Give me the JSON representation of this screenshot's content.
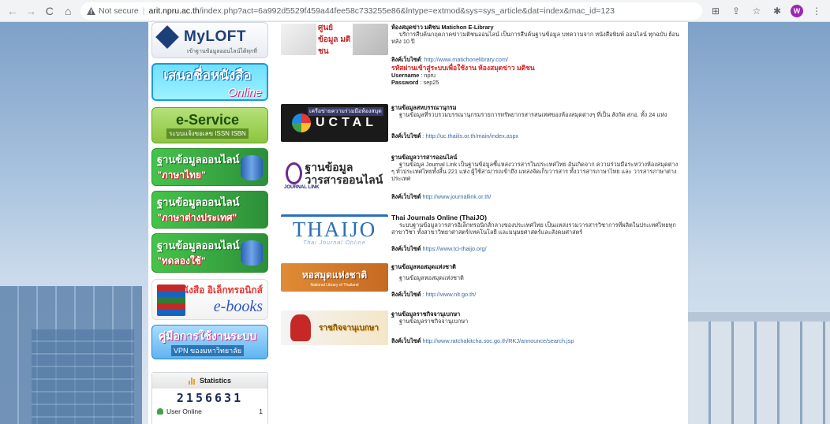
{
  "browser": {
    "nav": {
      "back": "←",
      "forward": "→",
      "reload": "C",
      "home": "⌂"
    },
    "security_label": "Not secure",
    "url_host": "arit.npru.ac.th",
    "url_rest": "/index.php?act=6a992d5529f459a44fee58c733255e86&lntype=extmod&sys=sys_article&dat=index&mac_id=123",
    "profile_initial": "W",
    "colors": {
      "profile": "#9c27b0"
    }
  },
  "sidebar": {
    "myloft": {
      "title": "MyLOFT",
      "subtitle": "เข้าฐานข้อมูลออนไลน์ได้ทุกที่"
    },
    "propose": {
      "line1": "เสนอชื่อหนังสือ",
      "line2": "Online"
    },
    "eservice": {
      "title": "e-Service",
      "subtitle": "ระบบแจ้งขอเลข ISSN ISBN"
    },
    "db_thai": {
      "line1": "ฐานข้อมูลออนไลน์",
      "line2": "\"ภาษาไทย\""
    },
    "db_foreign": {
      "line1": "ฐานข้อมูลออนไลน์",
      "line2": "\"ภาษาต่างประเทศ\""
    },
    "db_trial": {
      "line1": "ฐานข้อมูลออนไลน์",
      "line2": "\"ทดลองใช้\""
    },
    "ebooks": {
      "line1": "หนังสือ อิเล็กทรอนิกส์",
      "line2": "e-books"
    },
    "manual": {
      "line1": "คู่มือการใช้งานระบบ",
      "line2": "VPN ของมหาวิทยาลัย"
    },
    "stats": {
      "title": "Statistics",
      "counter": "2156631",
      "online_label": "User Online",
      "online_count": "1"
    }
  },
  "entries": {
    "matichon": {
      "logo_text": "ศูนย์ข้อมูล มติชน",
      "title": "ห้องสมุดข่าว มติชน Matichon E-Library",
      "desc": "บริการสืบค้นกฤตภาคข่าวมติชนออนไลน์ เป็นการสืบค้นฐานข้อมูล บทความจาก หนังสือพิมพ์ ออนไลน์ ทุกฉบับ ย้อนหลัง 10 ปี",
      "link_label": "ลิงค์เว็บไซต์",
      "link_url": ": http://www.matichonelibrary.com/",
      "warn": "รหัสผ่านเข้าสู่ระบบเพื่อใช้งาน ห้องสมุดข่าว มติชน",
      "username_label": "Username",
      "username": ": npru",
      "password_label": "Password",
      "password": ": sep25"
    },
    "uctal": {
      "logo_top": "เครือข่ายความร่วมมือห้องสมุด",
      "logo_text": "UCTAL",
      "title": "ฐานข้อมูลสหบรรณานุกรม",
      "desc": "ฐานข้อมูลที่รวบรวมบรรณานุกรมรายการทรัพยากรสารสนเทศของห้องสมุดต่างๆ ที่เป็น สังกัด สกอ. ทั้ง 24 แห่ง",
      "link_label": "ลิงค์เว็บไซต์",
      "link_url": " : http://uc.thailis.or.th/main/index.aspx"
    },
    "journallink": {
      "logo_text": "ฐานข้อมูลวารสารออนไลน์",
      "logo_small": "JOURNAL LINK",
      "title": "ฐานข้อมูลวารสารออนไลน์",
      "desc": "ฐานข้อมูล Journal Link เป็นฐานข้อมูลชี้แหล่งวารสารในประเทศไทย อันเกิดจาก ความร่วมมือระหว่างห้องสมุดต่าง ๆ ทั่วประเทศไทยทั้งสิ้น 221 แห่ง ผู้ใช้สามารถเข้าถึง แหล่งจัดเก็บวารสาร ทั้งวารสารภาษาไทย และ วารสารภาษาต่างประเทศ",
      "link_label": "ลิงค์เว็บไซต์",
      "link_url": " http://www.journallink.or.th/"
    },
    "thaijo": {
      "logo_main": "THAIJO",
      "logo_sub": "Thai Journal Online",
      "title": "Thai Journals Online (ThaiJO)",
      "desc": "ระบบฐานข้อมูลวารสารอิเล็กทรอนิกส์กลางของประเทศไทย เป็นแหล่งรวมวารสารวิชาการที่ผลิตในประเทศไทยทุกสาขาวิชา ทั้งสาขาวิทยาศาสตร์/เทคโนโลยี และมนุษยศาสตร์และสังคมศาสตร์",
      "link_label": "ลิงค์เว็บไซต์",
      "link_url": " https://www.tci-thaijo.org/"
    },
    "nlt": {
      "logo_text": "หอสมุดแห่งชาติ",
      "logo_sub": "National Library of Thailand",
      "title": "ฐานข้อมูลหอสมุดแห่งชาติ",
      "desc": "ฐานข้อมูลหอสมุดแห่งชาติ",
      "link_label": "ลิงค์เว็บไซต์",
      "link_url": " : http://www.nlt.go.th/"
    },
    "ratchakitcha": {
      "logo_text": "ราชกิจจานุเบกษา",
      "title": "ฐานข้อมูลราชกิจจานุเบกษา",
      "desc": "ฐานข้อมูลราชกิจจานุเบกษา",
      "link_label": "ลิงค์เว็บไซต์",
      "link_url": " http://www.ratchakitcha.soc.go.th/RKJ/announce/search.jsp"
    }
  }
}
